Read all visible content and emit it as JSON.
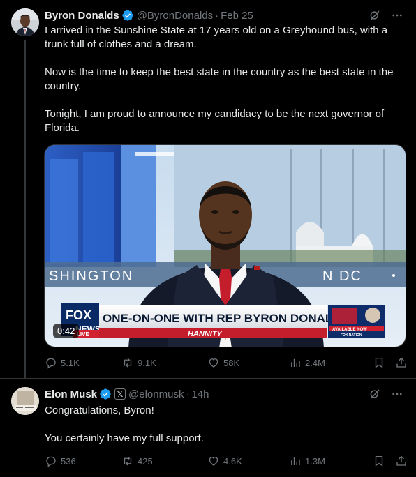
{
  "posts": [
    {
      "author": {
        "name": "Byron Donalds",
        "handle": "@ByronDonalds",
        "verified": true
      },
      "date": "Feb 25",
      "text": [
        "I arrived in the Sunshine State at 17 years old on a Greyhound bus, with a trunk full of clothes and a dream.",
        "Now is the time to keep the best state in the country as the best state in the country.",
        "Tonight, I am proud to announce my candidacy to be the next governor of Florida."
      ],
      "video": {
        "duration": "0:42",
        "backdrop_left": "SHINGTON",
        "backdrop_right": "N DC",
        "chyron": "ONE-ON-ONE WITH REP BYRON DONALDS",
        "show": "HANNITY",
        "network_top": "FOX",
        "network_bottom": "NEWS",
        "live": "LIVE",
        "promo": "AVAILABLE NOW",
        "promo_brand": "FOX NATION"
      },
      "stats": {
        "replies": "5.1K",
        "reposts": "9.1K",
        "likes": "58K",
        "views": "2.4M"
      }
    },
    {
      "author": {
        "name": "Elon Musk",
        "handle": "@elonmusk",
        "verified": true,
        "affiliate_badge": "𝕏"
      },
      "date": "14h",
      "text": [
        "Congratulations, Byron!",
        "You certainly have my full support."
      ],
      "stats": {
        "replies": "536",
        "reposts": "425",
        "likes": "4.6K",
        "views": "1.3M"
      }
    }
  ],
  "separator": "·",
  "colors": {
    "background": "#000000",
    "text": "#e7e9ea",
    "muted": "#71767b",
    "verified": "#1d9bf0",
    "border": "#2f3336"
  },
  "icons": [
    "grok-icon",
    "more-icon",
    "reply-icon",
    "repost-icon",
    "like-icon",
    "views-icon",
    "bookmark-icon",
    "share-icon",
    "verified-badge-icon",
    "x-affiliate-badge"
  ]
}
